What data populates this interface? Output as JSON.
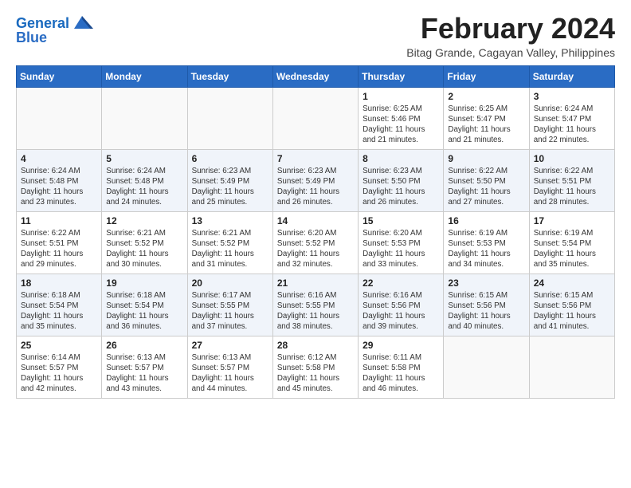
{
  "header": {
    "logo_line1": "General",
    "logo_line2": "Blue",
    "month_year": "February 2024",
    "location": "Bitag Grande, Cagayan Valley, Philippines"
  },
  "calendar": {
    "days_of_week": [
      "Sunday",
      "Monday",
      "Tuesday",
      "Wednesday",
      "Thursday",
      "Friday",
      "Saturday"
    ],
    "weeks": [
      [
        {
          "day": "",
          "info": ""
        },
        {
          "day": "",
          "info": ""
        },
        {
          "day": "",
          "info": ""
        },
        {
          "day": "",
          "info": ""
        },
        {
          "day": "1",
          "info": "Sunrise: 6:25 AM\nSunset: 5:46 PM\nDaylight: 11 hours and 21 minutes."
        },
        {
          "day": "2",
          "info": "Sunrise: 6:25 AM\nSunset: 5:47 PM\nDaylight: 11 hours and 21 minutes."
        },
        {
          "day": "3",
          "info": "Sunrise: 6:24 AM\nSunset: 5:47 PM\nDaylight: 11 hours and 22 minutes."
        }
      ],
      [
        {
          "day": "4",
          "info": "Sunrise: 6:24 AM\nSunset: 5:48 PM\nDaylight: 11 hours and 23 minutes."
        },
        {
          "day": "5",
          "info": "Sunrise: 6:24 AM\nSunset: 5:48 PM\nDaylight: 11 hours and 24 minutes."
        },
        {
          "day": "6",
          "info": "Sunrise: 6:23 AM\nSunset: 5:49 PM\nDaylight: 11 hours and 25 minutes."
        },
        {
          "day": "7",
          "info": "Sunrise: 6:23 AM\nSunset: 5:49 PM\nDaylight: 11 hours and 26 minutes."
        },
        {
          "day": "8",
          "info": "Sunrise: 6:23 AM\nSunset: 5:50 PM\nDaylight: 11 hours and 26 minutes."
        },
        {
          "day": "9",
          "info": "Sunrise: 6:22 AM\nSunset: 5:50 PM\nDaylight: 11 hours and 27 minutes."
        },
        {
          "day": "10",
          "info": "Sunrise: 6:22 AM\nSunset: 5:51 PM\nDaylight: 11 hours and 28 minutes."
        }
      ],
      [
        {
          "day": "11",
          "info": "Sunrise: 6:22 AM\nSunset: 5:51 PM\nDaylight: 11 hours and 29 minutes."
        },
        {
          "day": "12",
          "info": "Sunrise: 6:21 AM\nSunset: 5:52 PM\nDaylight: 11 hours and 30 minutes."
        },
        {
          "day": "13",
          "info": "Sunrise: 6:21 AM\nSunset: 5:52 PM\nDaylight: 11 hours and 31 minutes."
        },
        {
          "day": "14",
          "info": "Sunrise: 6:20 AM\nSunset: 5:52 PM\nDaylight: 11 hours and 32 minutes."
        },
        {
          "day": "15",
          "info": "Sunrise: 6:20 AM\nSunset: 5:53 PM\nDaylight: 11 hours and 33 minutes."
        },
        {
          "day": "16",
          "info": "Sunrise: 6:19 AM\nSunset: 5:53 PM\nDaylight: 11 hours and 34 minutes."
        },
        {
          "day": "17",
          "info": "Sunrise: 6:19 AM\nSunset: 5:54 PM\nDaylight: 11 hours and 35 minutes."
        }
      ],
      [
        {
          "day": "18",
          "info": "Sunrise: 6:18 AM\nSunset: 5:54 PM\nDaylight: 11 hours and 35 minutes."
        },
        {
          "day": "19",
          "info": "Sunrise: 6:18 AM\nSunset: 5:54 PM\nDaylight: 11 hours and 36 minutes."
        },
        {
          "day": "20",
          "info": "Sunrise: 6:17 AM\nSunset: 5:55 PM\nDaylight: 11 hours and 37 minutes."
        },
        {
          "day": "21",
          "info": "Sunrise: 6:16 AM\nSunset: 5:55 PM\nDaylight: 11 hours and 38 minutes."
        },
        {
          "day": "22",
          "info": "Sunrise: 6:16 AM\nSunset: 5:56 PM\nDaylight: 11 hours and 39 minutes."
        },
        {
          "day": "23",
          "info": "Sunrise: 6:15 AM\nSunset: 5:56 PM\nDaylight: 11 hours and 40 minutes."
        },
        {
          "day": "24",
          "info": "Sunrise: 6:15 AM\nSunset: 5:56 PM\nDaylight: 11 hours and 41 minutes."
        }
      ],
      [
        {
          "day": "25",
          "info": "Sunrise: 6:14 AM\nSunset: 5:57 PM\nDaylight: 11 hours and 42 minutes."
        },
        {
          "day": "26",
          "info": "Sunrise: 6:13 AM\nSunset: 5:57 PM\nDaylight: 11 hours and 43 minutes."
        },
        {
          "day": "27",
          "info": "Sunrise: 6:13 AM\nSunset: 5:57 PM\nDaylight: 11 hours and 44 minutes."
        },
        {
          "day": "28",
          "info": "Sunrise: 6:12 AM\nSunset: 5:58 PM\nDaylight: 11 hours and 45 minutes."
        },
        {
          "day": "29",
          "info": "Sunrise: 6:11 AM\nSunset: 5:58 PM\nDaylight: 11 hours and 46 minutes."
        },
        {
          "day": "",
          "info": ""
        },
        {
          "day": "",
          "info": ""
        }
      ]
    ]
  }
}
